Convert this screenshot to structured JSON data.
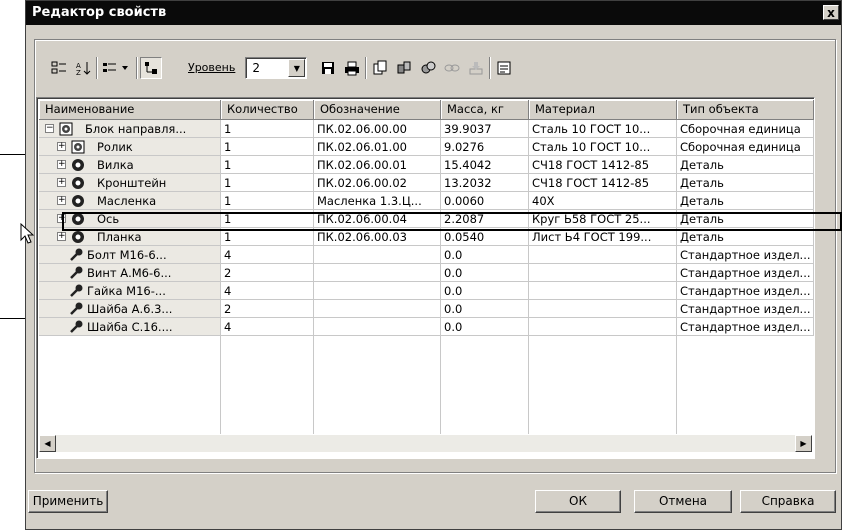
{
  "window": {
    "title": "Редактор свойств",
    "close_glyph": "x"
  },
  "toolbar": {
    "level_label": "Уровень",
    "level_value": "2",
    "icons": [
      "tree-select-icon",
      "sort-icon",
      "view-menu-icon",
      "structure-icon",
      "level-dropdown-icon",
      "save-icon",
      "print-icon",
      "copy-icon",
      "assembly-icon",
      "parts-icon",
      "link-icon",
      "archive-icon",
      "report-icon"
    ]
  },
  "table": {
    "columns": [
      "Наименование",
      "Количество",
      "Обозначение",
      "Масса, кг",
      "Материал",
      "Тип объекта"
    ],
    "rows": [
      {
        "name": "Блок направля...",
        "qty": "1",
        "code": "ПК.02.06.00.00",
        "mass": "39.9037",
        "material": "Сталь 10  ГОСТ 10...",
        "type": "Сборочная единица",
        "level": 0,
        "expander": "minus",
        "icon": "assembly-icon"
      },
      {
        "name": "Ролик",
        "qty": "1",
        "code": "ПК.02.06.01.00",
        "mass": "9.0276",
        "material": "Сталь 10  ГОСТ 10...",
        "type": "Сборочная единица",
        "level": 1,
        "expander": "plus",
        "icon": "assembly-icon"
      },
      {
        "name": "Вилка",
        "qty": "1",
        "code": "ПК.02.06.00.01",
        "mass": "15.4042",
        "material": "СЧ18 ГОСТ 1412-85",
        "type": "Деталь",
        "level": 1,
        "expander": "plus",
        "icon": "part-icon"
      },
      {
        "name": "Кронштейн",
        "qty": "1",
        "code": "ПК.02.06.00.02",
        "mass": "13.2032",
        "material": "СЧ18 ГОСТ 1412-85",
        "type": "Деталь",
        "level": 1,
        "expander": "plus",
        "icon": "part-icon"
      },
      {
        "name": "Масленка",
        "qty": "1",
        "code": "Масленка  1.3.Ц...",
        "mass": "0.0060",
        "material": "40Х",
        "type": "Деталь",
        "level": 1,
        "expander": "plus",
        "icon": "part-icon"
      },
      {
        "name": "Ось",
        "qty": "1",
        "code": "ПК.02.06.00.04",
        "mass": "2.2087",
        "material": "Круг  Ь58  ГОСТ 25...",
        "type": "Деталь",
        "level": 1,
        "expander": "plus",
        "icon": "part-icon"
      },
      {
        "name": "Планка",
        "qty": "1",
        "code": "ПК.02.06.00.03",
        "mass": "0.0540",
        "material": "Лист  Ь4 ГОСТ 199...",
        "type": "Деталь",
        "level": 1,
        "expander": "plus",
        "icon": "part-icon"
      },
      {
        "name": "Болт М16-6...",
        "qty": "4",
        "code": "",
        "mass": "0.0",
        "material": "",
        "type": "Стандартное издел...",
        "level": 2,
        "expander": "",
        "icon": "standard-part-icon"
      },
      {
        "name": "Винт А.М6-6...",
        "qty": "2",
        "code": "",
        "mass": "0.0",
        "material": "",
        "type": "Стандартное издел...",
        "level": 2,
        "expander": "",
        "icon": "standard-part-icon"
      },
      {
        "name": "Гайка  М16-...",
        "qty": "4",
        "code": "",
        "mass": "0.0",
        "material": "",
        "type": "Стандартное издел...",
        "level": 2,
        "expander": "",
        "icon": "standard-part-icon"
      },
      {
        "name": "Шайба А.6.3...",
        "qty": "2",
        "code": "",
        "mass": "0.0",
        "material": "",
        "type": "Стандартное издел...",
        "level": 2,
        "expander": "",
        "icon": "standard-part-icon"
      },
      {
        "name": "Шайба С.16....",
        "qty": "4",
        "code": "",
        "mass": "0.0",
        "material": "",
        "type": "Стандартное издел...",
        "level": 2,
        "expander": "",
        "icon": "standard-part-icon"
      }
    ]
  },
  "buttons": {
    "apply": "Применить",
    "ok": "ОК",
    "cancel": "Отмена",
    "help": "Справка"
  }
}
